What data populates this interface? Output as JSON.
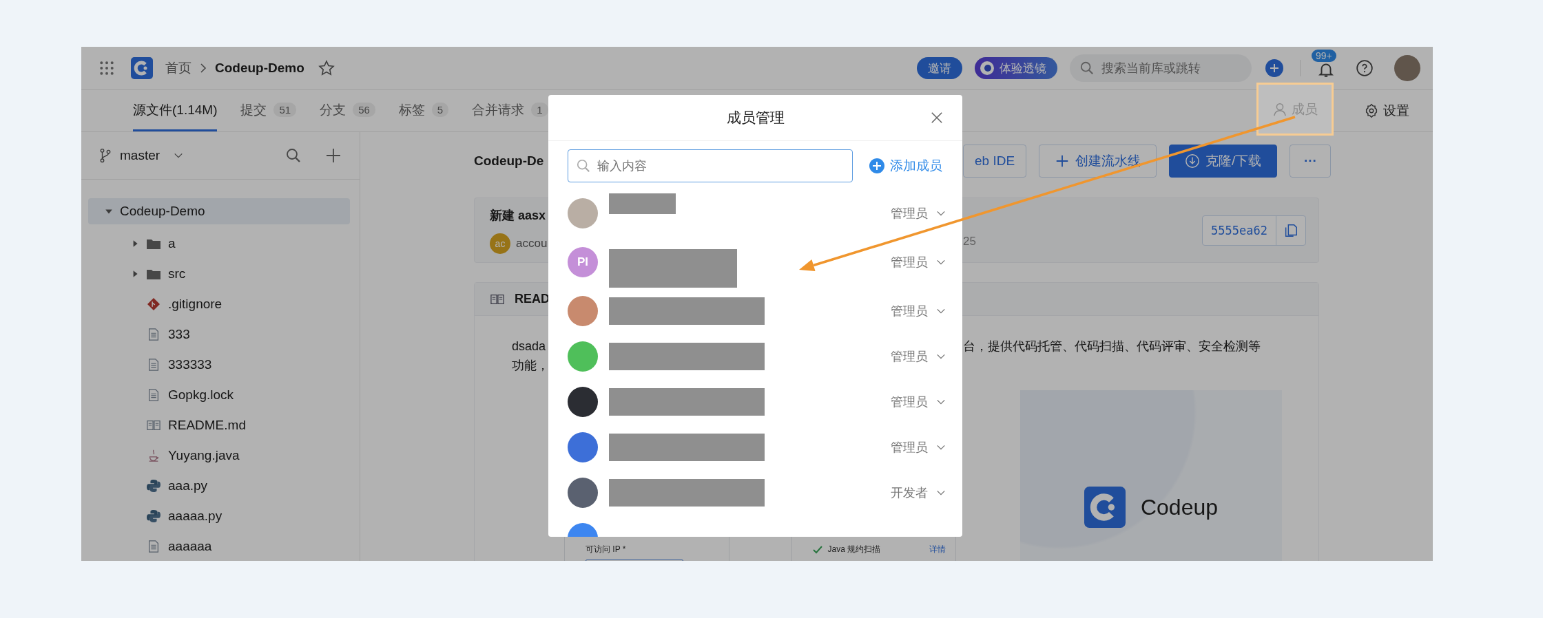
{
  "top_bar": {
    "breadcrumb": [
      {
        "label": "首页",
        "current": false
      },
      {
        "label": "Codeup-Demo",
        "current": true
      }
    ],
    "invite_button": "邀请",
    "lens_button": "体验透镜",
    "search": {
      "placeholder": "搜索当前库或跳转"
    },
    "notifications": "99+"
  },
  "tabs": [
    {
      "label": "源文件(1.14M)",
      "selected": true
    },
    {
      "label": "提交",
      "count": "51",
      "selected": false
    },
    {
      "label": "分支",
      "count": "56",
      "selected": false
    },
    {
      "label": "标签",
      "count": "5",
      "selected": false
    },
    {
      "label": "合并请求",
      "count": "1",
      "selected": false
    }
  ],
  "tab_actions": [
    {
      "label": "成员",
      "kind": "members",
      "highlighted": true
    },
    {
      "label": "设置",
      "kind": "settings",
      "highlighted": false
    }
  ],
  "sidebar": {
    "branch": "master",
    "tree": [
      {
        "name": "Codeup-Demo",
        "kind": "folder",
        "expanded": true,
        "selected": true,
        "children": [
          {
            "name": "a",
            "kind": "folder",
            "expanded": false,
            "selected": false
          },
          {
            "name": "src",
            "kind": "folder",
            "expanded": false,
            "selected": false
          },
          {
            "name": ".gitignore",
            "kind": "git",
            "selected": false
          },
          {
            "name": "333",
            "kind": "text",
            "selected": false
          },
          {
            "name": "333333",
            "kind": "text",
            "selected": false
          },
          {
            "name": "Gopkg.lock",
            "kind": "text",
            "selected": false
          },
          {
            "name": "README.md",
            "kind": "readme",
            "selected": false
          },
          {
            "name": "Yuyang.java",
            "kind": "java",
            "selected": false
          },
          {
            "name": "aaa.py",
            "kind": "python",
            "selected": false
          },
          {
            "name": "aaaaa.py",
            "kind": "python",
            "selected": false
          },
          {
            "name": "aaaaaa",
            "kind": "text",
            "selected": false
          }
        ]
      }
    ]
  },
  "content": {
    "title": "Codeup-De",
    "buttons": [
      {
        "label": "eb IDE",
        "kind": "outline"
      },
      {
        "label": "创建流水线",
        "kind": "add"
      },
      {
        "label": "克隆/下载",
        "kind": "primary"
      },
      {
        "label": "···",
        "kind": "more"
      }
    ],
    "commit": {
      "message": "新建 aasx",
      "author_initials": "ac",
      "author": "accou",
      "time": "25",
      "hash": "5555ea62"
    },
    "readme": {
      "title": "READ",
      "lines": [
        {
          "left": "dsada",
          "right": "台，提供代码托管、代码扫描、代码评审、安全检测等"
        },
        {
          "left": "功能，"
        }
      ],
      "image": {
        "field_label": "可访问 IP *",
        "scan_label": "Java 规约扫描",
        "scan_link": "详情",
        "logo_text": "Codeup"
      }
    }
  },
  "modal": {
    "title": "成员管理",
    "search": {
      "placeholder": "输入内容"
    },
    "add_button": "添加成员",
    "members": [
      {
        "kind": "photo",
        "color": "#b9aea4",
        "role": "管理员"
      },
      {
        "kind": "initials",
        "initials": "PI",
        "color": "#c48fd8",
        "role": "管理员"
      },
      {
        "kind": "photo",
        "color": "#c88a6e",
        "role": "管理员"
      },
      {
        "kind": "photo",
        "color": "#4fbf5a",
        "role": "管理员"
      },
      {
        "kind": "photo",
        "color": "#2b2d33",
        "role": "管理员"
      },
      {
        "kind": "photo",
        "color": "#3d6fd8",
        "role": "管理员"
      },
      {
        "kind": "photo",
        "color": "#5a6170",
        "role": "开发者"
      },
      {
        "kind": "photo",
        "color": "#3d86f0"
      }
    ]
  }
}
